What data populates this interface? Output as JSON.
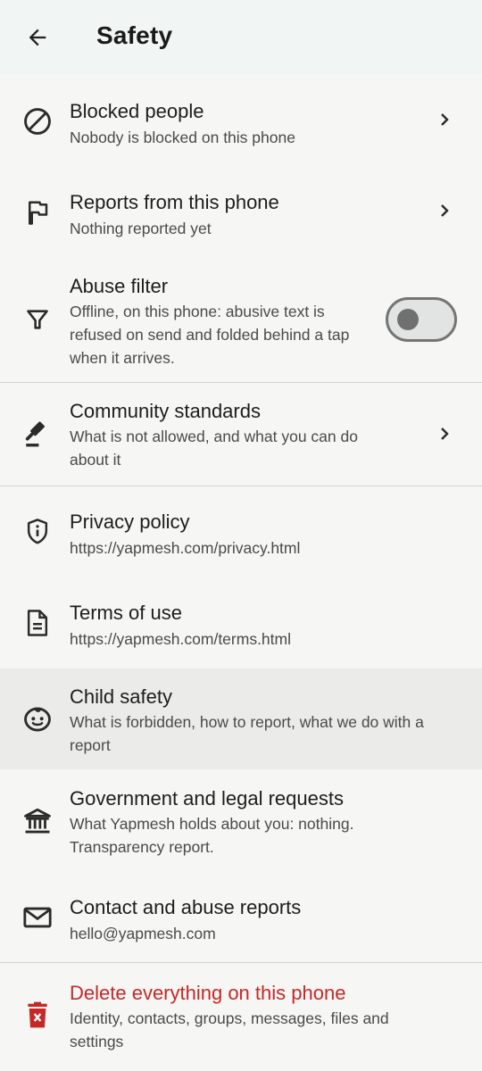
{
  "header": {
    "title": "Safety"
  },
  "items": [
    {
      "title": "Blocked people",
      "subtitle": "Nobody is blocked on this phone",
      "icon": "block-icon"
    },
    {
      "title": "Reports from this phone",
      "subtitle": "Nothing reported yet",
      "icon": "flag-icon"
    },
    {
      "title": "Abuse filter",
      "subtitle": "Offline, on this phone: abusive text is refused on send and folded behind a tap when it arrives.",
      "icon": "filter-icon",
      "toggle_on": false
    },
    {
      "title": "Community standards",
      "subtitle": "What is not allowed, and what you can do about it",
      "icon": "gavel-icon"
    },
    {
      "title": "Privacy policy",
      "subtitle": "https://yapmesh.com/privacy.html",
      "icon": "shield-info-icon"
    },
    {
      "title": "Terms of use",
      "subtitle": "https://yapmesh.com/terms.html",
      "icon": "document-icon"
    },
    {
      "title": "Child safety",
      "subtitle": "What is forbidden, how to report, what we do with a report",
      "icon": "child-face-icon"
    },
    {
      "title": "Government and legal requests",
      "subtitle": "What Yapmesh holds about you: nothing. Transparency report.",
      "icon": "bank-icon"
    },
    {
      "title": "Contact and abuse reports",
      "subtitle": "hello@yapmesh.com",
      "icon": "mail-icon"
    },
    {
      "title": "Delete everything on this phone",
      "subtitle": "Identity, contacts, groups, messages, files and settings",
      "icon": "trash-icon"
    }
  ],
  "colors": {
    "danger": "#c62828",
    "icon": "#2b2b2b",
    "highlight": "#ebebea"
  }
}
